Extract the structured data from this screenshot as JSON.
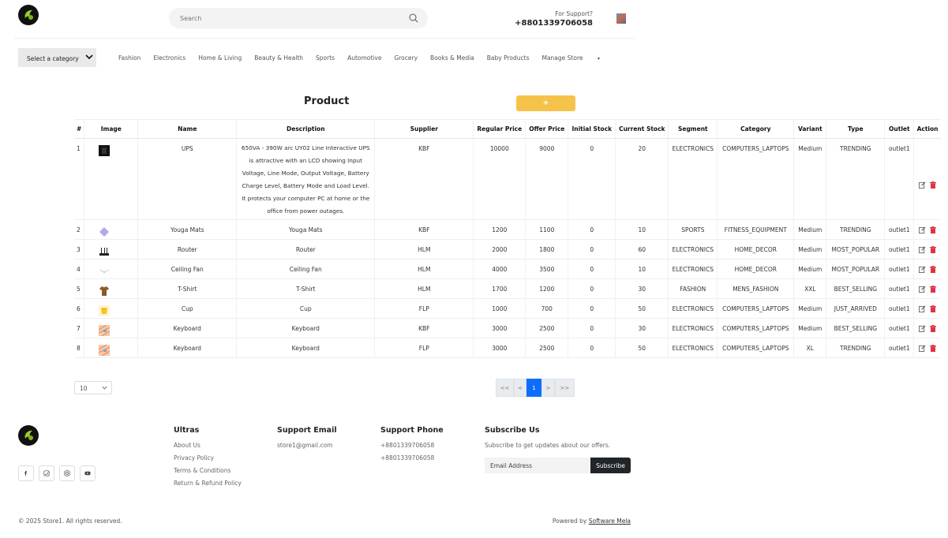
{
  "header": {
    "search_placeholder": "Search",
    "support_label": "For Support?",
    "support_phone": "+8801339706058"
  },
  "nav": {
    "category_select": "Select a category",
    "items": [
      "Fashion",
      "Electronics",
      "Home & Living",
      "Beauty & Health",
      "Sports",
      "Automotive",
      "Grocery",
      "Books & Media",
      "Baby Products"
    ],
    "manage_store": "Manage Store"
  },
  "product": {
    "title": "Product",
    "add_label": "+",
    "columns": [
      "#",
      "Image",
      "Name",
      "Description",
      "Supplier",
      "Regular Price",
      "Offer Price",
      "Initial Stock",
      "Current Stock",
      "Segment",
      "Category",
      "Variant",
      "Type",
      "Outlet",
      "Action"
    ],
    "rows": [
      {
        "n": "1",
        "img": "ups-image",
        "name": "UPS",
        "desc": "650VA - 390W arc UY02 Line Interactive UPS is attractive with an LCD showing Input Voltage, Line Mode, Output Voltage, Battery Charge Level, Battery Mode and Load Level. It protects your computer PC at home or the office from power outages.",
        "supplier": "KBF",
        "regular": "10000",
        "offer": "9000",
        "initial": "0",
        "current": "20",
        "segment": "ELECTRONICS",
        "category": "COMPUTERS_LAPTOPS",
        "variant": "Medium",
        "type": "TRENDING",
        "outlet": "outlet1"
      },
      {
        "n": "2",
        "img": "yoga-mat-image",
        "name": "Youga Mats",
        "desc": "Youga Mats",
        "supplier": "KBF",
        "regular": "1200",
        "offer": "1100",
        "initial": "0",
        "current": "10",
        "segment": "SPORTS",
        "category": "FITNESS_EQUIPMENT",
        "variant": "Medium",
        "type": "TRENDING",
        "outlet": "outlet1"
      },
      {
        "n": "3",
        "img": "router-image",
        "name": "Router",
        "desc": "Router",
        "supplier": "HLM",
        "regular": "2000",
        "offer": "1800",
        "initial": "0",
        "current": "60",
        "segment": "ELECTRONICS",
        "category": "HOME_DECOR",
        "variant": "Medium",
        "type": "MOST_POPULAR",
        "outlet": "outlet1"
      },
      {
        "n": "4",
        "img": "ceiling-fan-image",
        "name": "Ceiling Fan",
        "desc": "Ceiling Fan",
        "supplier": "HLM",
        "regular": "4000",
        "offer": "3500",
        "initial": "0",
        "current": "10",
        "segment": "ELECTRONICS",
        "category": "HOME_DECOR",
        "variant": "Medium",
        "type": "MOST_POPULAR",
        "outlet": "outlet1"
      },
      {
        "n": "5",
        "img": "tshirt-image",
        "name": "T-Shirt",
        "desc": "T-Shirt",
        "supplier": "HLM",
        "regular": "1700",
        "offer": "1200",
        "initial": "0",
        "current": "30",
        "segment": "FASHION",
        "category": "MENS_FASHION",
        "variant": "XXL",
        "type": "BEST_SELLING",
        "outlet": "outlet1"
      },
      {
        "n": "6",
        "img": "cup-image",
        "name": "Cup",
        "desc": "Cup",
        "supplier": "FLP",
        "regular": "1000",
        "offer": "700",
        "initial": "0",
        "current": "50",
        "segment": "ELECTRONICS",
        "category": "COMPUTERS_LAPTOPS",
        "variant": "Medium",
        "type": "JUST_ARRIVED",
        "outlet": "outlet1"
      },
      {
        "n": "7",
        "img": "keyboard-image",
        "name": "Keyboard",
        "desc": "Keyboard",
        "supplier": "KBF",
        "regular": "3000",
        "offer": "2500",
        "initial": "0",
        "current": "30",
        "segment": "ELECTRONICS",
        "category": "COMPUTERS_LAPTOPS",
        "variant": "Medium",
        "type": "BEST_SELLING",
        "outlet": "outlet1"
      },
      {
        "n": "8",
        "img": "keyboard-image",
        "name": "Keyboard",
        "desc": "Keyboard",
        "supplier": "FLP",
        "regular": "3000",
        "offer": "2500",
        "initial": "0",
        "current": "50",
        "segment": "ELECTRONICS",
        "category": "COMPUTERS_LAPTOPS",
        "variant": "XL",
        "type": "TRENDING",
        "outlet": "outlet1"
      }
    ]
  },
  "pagination": {
    "page_size": "10",
    "first": "<<",
    "prev": "<",
    "current": "1",
    "next": ">",
    "last": ">>"
  },
  "footer": {
    "col1_title": "Ultras",
    "col1_links": [
      "About Us",
      "Privacy Policy",
      "Terms & Conditions",
      "Return & Refund Policy"
    ],
    "email_title": "Support Email",
    "email": "store1@gmail.com",
    "phone_title": "Support Phone",
    "phones": [
      "+8801339706058",
      "+8801339706058"
    ],
    "subscribe_title": "Subscribe Us",
    "subscribe_text": "Subscribe to get updates about our offers.",
    "email_placeholder": "Email Address",
    "subscribe_button": "Subscribe",
    "copyright": "© 2025 Store1. All rights reserved.",
    "powered_prefix": "Powered by",
    "powered_link": "Software Mela"
  },
  "colors": {
    "accent": "#f5c34a",
    "pager_active": "#0d6efd",
    "delete": "#dc3545"
  }
}
